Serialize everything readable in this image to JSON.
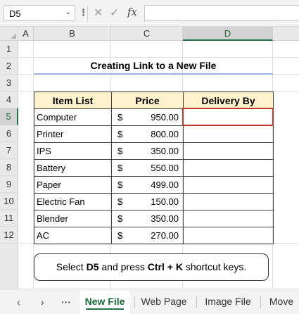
{
  "formula_bar": {
    "name_box": "D5",
    "name_box_caret": "⌄",
    "more_icon": "⋮",
    "cancel_icon": "✕",
    "enter_icon": "✓",
    "fx_label": "fx",
    "formula": ""
  },
  "columns": [
    "A",
    "B",
    "C",
    "D"
  ],
  "rows": [
    "1",
    "2",
    "3",
    "4",
    "5",
    "6",
    "7",
    "8",
    "9",
    "10",
    "11",
    "12"
  ],
  "selected_cell": "D5",
  "sheet": {
    "title": "Creating Link to a New File",
    "headers": {
      "item": "Item List",
      "price": "Price",
      "delivery": "Delivery By"
    },
    "currency_symbol": "$",
    "items": [
      {
        "item": "Computer",
        "price": "950.00",
        "delivery": ""
      },
      {
        "item": "Printer",
        "price": "800.00",
        "delivery": ""
      },
      {
        "item": "IPS",
        "price": "350.00",
        "delivery": ""
      },
      {
        "item": "Battery",
        "price": "550.00",
        "delivery": ""
      },
      {
        "item": "Paper",
        "price": "499.00",
        "delivery": ""
      },
      {
        "item": "Electric Fan",
        "price": "150.00",
        "delivery": ""
      },
      {
        "item": "Blender",
        "price": "350.00",
        "delivery": ""
      },
      {
        "item": "AC",
        "price": "270.00",
        "delivery": ""
      }
    ]
  },
  "instruction": {
    "prefix": "Select ",
    "cell": "D5",
    "middle": " and press ",
    "key1": "Ctrl",
    "plus": " + ",
    "key2": "K",
    "suffix": " shortcut keys."
  },
  "tabs": {
    "nav_prev": "‹",
    "nav_next": "›",
    "nav_more": "···",
    "items": [
      "New File",
      "Web Page",
      "Image File",
      "Move"
    ],
    "active": "New File"
  },
  "colors": {
    "header_fill": "#fff2cc",
    "active_cell_border": "#c0392b",
    "selection_green": "#217346",
    "title_underline": "#9db4dc"
  }
}
